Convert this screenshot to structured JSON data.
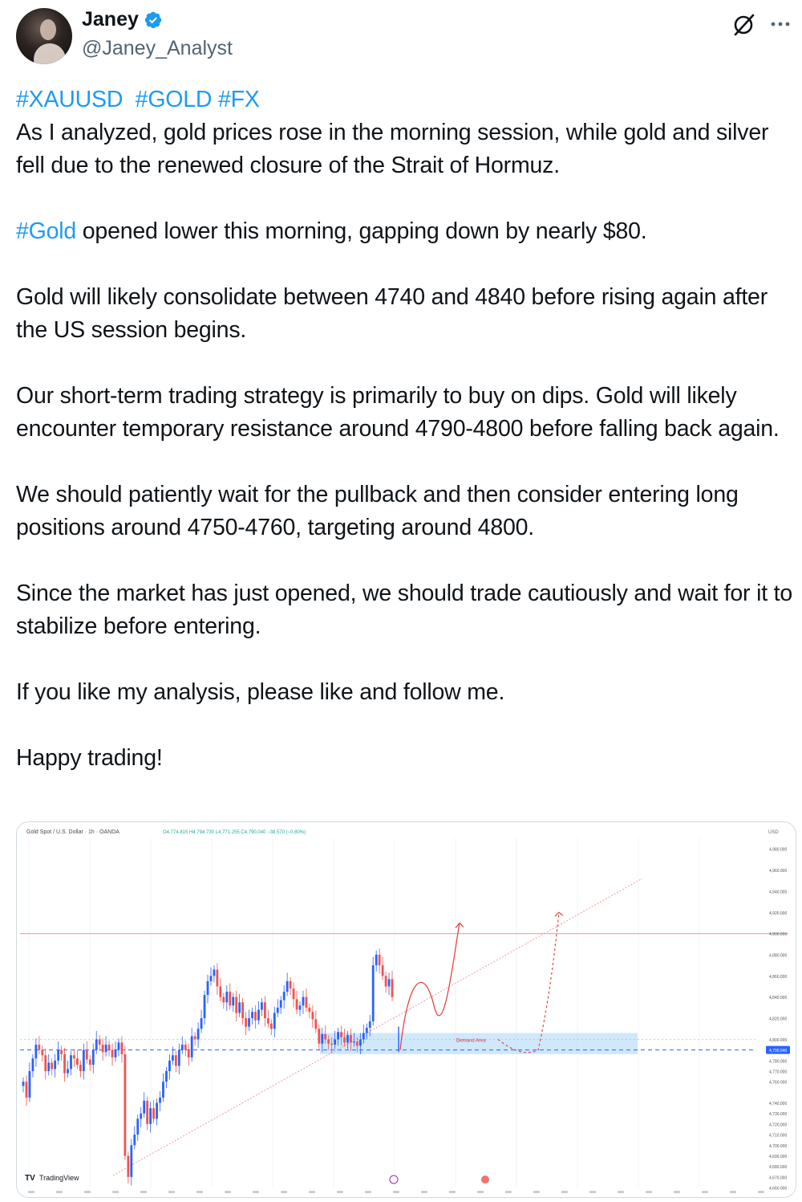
{
  "author": {
    "name": "Janey",
    "handle": "@Janey_Analyst",
    "verified": true,
    "avatar_icon": "avatar-photo"
  },
  "actions": {
    "grok_icon": "grok-icon",
    "more_icon": "more-icon"
  },
  "tweet": {
    "hashtags_line": [
      "#XAUUSD",
      "#GOLD",
      "#FX"
    ],
    "p1": "As I analyzed, gold prices rose in the morning session, while gold and silver fell due to the renewed closure of the Strait of Hormuz.",
    "p2_tag": "#Gold",
    "p2_rest": " opened lower this morning, gapping down by nearly $80.",
    "p3": "Gold will likely consolidate between 4740 and 4840 before rising again after the US session begins.",
    "p4": "Our short-term trading strategy is primarily to buy on dips. Gold will likely encounter temporary resistance around 4790-4800 before falling back again.",
    "p5": "We should patiently wait for the pullback and then consider entering long positions around 4750-4760, targeting around 4800.",
    "p6": "Since the market has just opened, we should trade cautiously and wait for it to stabilize before entering.",
    "p7": "If you like my analysis, please like and follow me.",
    "p8": "Happy trading!"
  },
  "chart": {
    "symbol_line": "Gold Spot / U.S. Dollar · 1h · OANDA",
    "ohlc_line": "O4,774.815 H4,794.730 L4,771.255 C4,790.040 −38.570 (−0.80%)",
    "currency": "USD",
    "demand_label": "Demand Area",
    "watermark": "TradingView",
    "colors": {
      "up": "#26a69a",
      "down": "#ef5350",
      "candle_bull": "#2962ff",
      "candle_bear": "#ef5350",
      "resistance_line": "#f7a6a6",
      "support_line": "#2962ff",
      "demand_zone": "#bbdefb",
      "projection": "#e53935"
    }
  },
  "chart_data": {
    "type": "candlestick",
    "title": "Gold Spot / U.S. Dollar · 1h · OANDA",
    "ylabel": "USD",
    "ylim": [
      4660,
      4990
    ],
    "y_ticks": [
      "4,980.000",
      "4,960.000",
      "4,940.000",
      "4,920.000",
      "4,900.000",
      "4,880.000",
      "4,860.000",
      "4,840.000",
      "4,820.000",
      "4,800.000",
      "4,790.040",
      "4,780.000",
      "4,770.000",
      "4,760.000",
      "4,740.000",
      "4,730.000",
      "4,720.000",
      "4,710.000",
      "4,700.000",
      "4,690.000",
      "4,680.000",
      "4,670.000",
      "4,660.000"
    ],
    "close_series": [
      4760,
      4745,
      4770,
      4782,
      4795,
      4790,
      4785,
      4770,
      4778,
      4772,
      4780,
      4790,
      4786,
      4768,
      4772,
      4785,
      4782,
      4776,
      4770,
      4790,
      4781,
      4776,
      4790,
      4800,
      4795,
      4788,
      4795,
      4790,
      4783,
      4790,
      4797,
      4786,
      4690,
      4670,
      4700,
      4710,
      4725,
      4730,
      4742,
      4720,
      4735,
      4725,
      4740,
      4745,
      4760,
      4770,
      4780,
      4785,
      4775,
      4790,
      4795,
      4790,
      4783,
      4803,
      4800,
      4810,
      4820,
      4842,
      4855,
      4860,
      4866,
      4850,
      4840,
      4835,
      4845,
      4832,
      4840,
      4825,
      4835,
      4820,
      4812,
      4820,
      4826,
      4818,
      4828,
      4835,
      4820,
      4815,
      4810,
      4825,
      4830,
      4837,
      4845,
      4855,
      4848,
      4838,
      4828,
      4832,
      4840,
      4830,
      4826,
      4819,
      4810,
      4796,
      4805,
      4800,
      4796,
      4795,
      4800,
      4807,
      4802,
      4797,
      4804,
      4797,
      4798,
      4794,
      4800,
      4806,
      4811,
      4817,
      4870,
      4880,
      4870,
      4860,
      4850,
      4857,
      4840
    ],
    "levels": {
      "resistance": 4900,
      "support_dashed": 4790,
      "demand_zone": [
        4786,
        4806
      ]
    },
    "annotations": [
      "Demand Area"
    ]
  }
}
